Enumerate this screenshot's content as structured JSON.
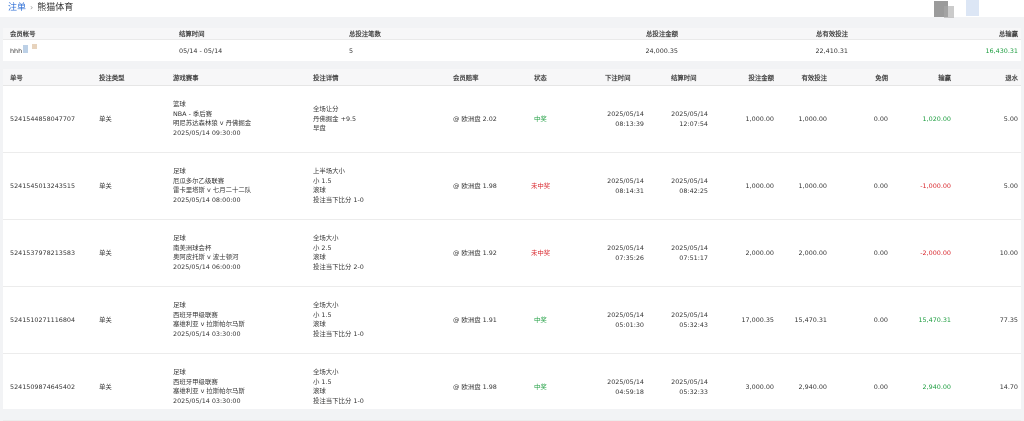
{
  "breadcrumb": {
    "root": "注单",
    "current": "熊猫体育"
  },
  "summary": {
    "headers": [
      "会员帐号",
      "结算时间",
      "总投注笔数",
      "总投注金额",
      "总有效投注",
      "总输赢"
    ],
    "account": "hhh",
    "period": "05/14 - 05/14",
    "count": "5",
    "amount": "24,000.35",
    "effective": "22,410.31",
    "winloss": "16,430.31"
  },
  "table": {
    "headers": [
      "单号",
      "投注类型",
      "游戏赛事",
      "投注详情",
      "会员赔率",
      "状态",
      "下注时间",
      "结算时间",
      "投注金额",
      "有效投注",
      "免佣",
      "输赢",
      "退水"
    ],
    "rows": [
      {
        "id": "5241544858047707",
        "type": "单关",
        "event": [
          "篮球",
          "NBA - 季后赛",
          "明尼苏达森林狼 v 丹佛掘金",
          "2025/05/14 09:30:00"
        ],
        "detail": [
          "全场让分",
          "丹佛掘金 +9.5",
          "早盘"
        ],
        "odds": "@ 欧洲盘 2.02",
        "status": "中奖",
        "bet_date": "2025/05/14",
        "bet_time": "08:13:39",
        "settle_date": "2025/05/14",
        "settle_time": "12:07:54",
        "amount": "1,000.00",
        "effective": "1,000.00",
        "commission": "0.00",
        "winloss": "1,020.00",
        "rebate": "5.00"
      },
      {
        "id": "5241545013243515",
        "type": "单关",
        "event": [
          "足球",
          "厄瓜多尔乙级联赛",
          "雷卡里塔斯 v 七月二十二队",
          "2025/05/14 08:00:00"
        ],
        "detail": [
          "上半场大小",
          "小 1.5",
          "滚球",
          "投注当下比分 1-0"
        ],
        "odds": "@ 欧洲盘 1.98",
        "status": "未中奖",
        "bet_date": "2025/05/14",
        "bet_time": "08:14:31",
        "settle_date": "2025/05/14",
        "settle_time": "08:42:25",
        "amount": "1,000.00",
        "effective": "1,000.00",
        "commission": "0.00",
        "winloss": "-1,000.00",
        "rebate": "5.00"
      },
      {
        "id": "5241537978213583",
        "type": "单关",
        "event": [
          "足球",
          "南美洲球会杯",
          "奥阿皮托斯 v 波士顿河",
          "2025/05/14 06:00:00"
        ],
        "detail": [
          "全场大小",
          "小 2.5",
          "滚球",
          "投注当下比分 2-0"
        ],
        "odds": "@ 欧洲盘 1.92",
        "status": "未中奖",
        "bet_date": "2025/05/14",
        "bet_time": "07:35:26",
        "settle_date": "2025/05/14",
        "settle_time": "07:51:17",
        "amount": "2,000.00",
        "effective": "2,000.00",
        "commission": "0.00",
        "winloss": "-2,000.00",
        "rebate": "10.00"
      },
      {
        "id": "5241510271116804",
        "type": "单关",
        "event": [
          "足球",
          "西班牙甲级联赛",
          "塞维利亚 v 拉斯帕尔马斯",
          "2025/05/14 03:30:00"
        ],
        "detail": [
          "全场大小",
          "小 1.5",
          "滚球",
          "投注当下比分 1-0"
        ],
        "odds": "@ 欧洲盘 1.91",
        "status": "中奖",
        "bet_date": "2025/05/14",
        "bet_time": "05:01:30",
        "settle_date": "2025/05/14",
        "settle_time": "05:32:43",
        "amount": "17,000.35",
        "effective": "15,470.31",
        "commission": "0.00",
        "winloss": "15,470.31",
        "rebate": "77.35"
      },
      {
        "id": "5241509874645402",
        "type": "单关",
        "event": [
          "足球",
          "西班牙甲级联赛",
          "塞维利亚 v 拉斯帕尔马斯",
          "2025/05/14 03:30:00"
        ],
        "detail": [
          "全场大小",
          "小 1.5",
          "滚球",
          "投注当下比分 1-0"
        ],
        "odds": "@ 欧洲盘 1.98",
        "status": "中奖",
        "bet_date": "2025/05/14",
        "bet_time": "04:59:18",
        "settle_date": "2025/05/14",
        "settle_time": "05:32:33",
        "amount": "3,000.00",
        "effective": "2,940.00",
        "commission": "0.00",
        "winloss": "2,940.00",
        "rebate": "14.70"
      }
    ]
  },
  "colors": {
    "win": "#1a9c3d",
    "lose": "#d9262c",
    "link": "#2f6fd6"
  }
}
